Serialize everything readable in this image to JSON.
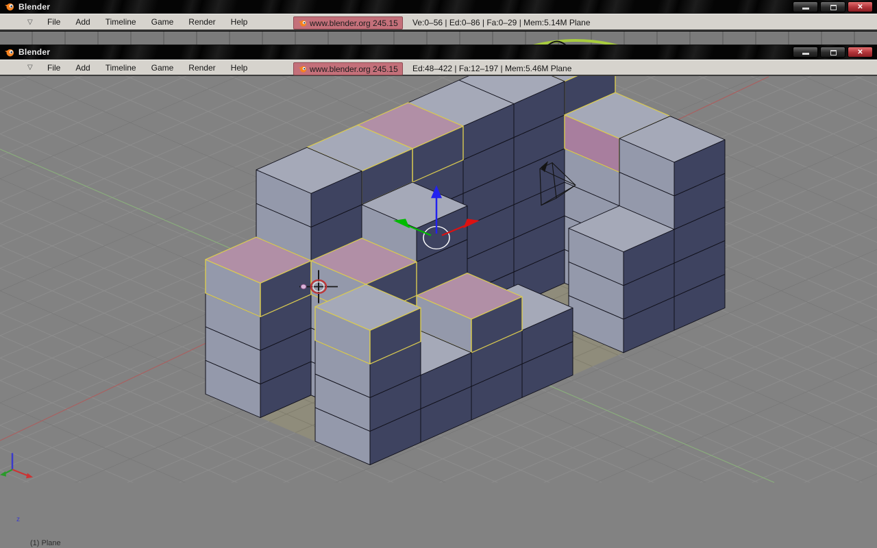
{
  "window1": {
    "title": "Blender",
    "menu": [
      "File",
      "Add",
      "Timeline",
      "Game",
      "Render",
      "Help"
    ],
    "version_badge": "www.blender.org 245.15",
    "stats": "Ve:0–56 | Ed:0–86 | Fa:0–29 | Mem:5.14M Plane"
  },
  "window2": {
    "title": "Blender",
    "menu": [
      "File",
      "Add",
      "Timeline",
      "Game",
      "Render",
      "Help"
    ],
    "version_badge": "www.blender.org 245.15",
    "stats": "Ed:48–422 | Fa:12–197 | Mem:5.46M Plane"
  },
  "icons": {
    "menu_collapse": "▽",
    "close": "✕"
  },
  "viewport": {
    "object_label": "(1) Plane",
    "axis_z_label": "z",
    "colors": {
      "background": "#828282",
      "grid_light": "#8e8e8e",
      "grid_dark": "#757575",
      "axis_x_red": "#aa5f5f",
      "axis_y_green": "#8aad7c",
      "floor": "#8f8c7b",
      "floor_grid": "#7e7b6b",
      "face_top": "#a5a9b8",
      "face_left": "#9499ab",
      "face_right": "#3e4360",
      "face_selected": "#b18fa6",
      "face_selected_side": "#a87e9e",
      "edge": "#10101a",
      "select_edge": "#d9ca52",
      "manip_x": "#dd1111",
      "manip_y": "#00bb00",
      "manip_z": "#2222ee",
      "cursor_red": "#c03535",
      "gizmo_blue": "#3a3acc",
      "gizmo_red": "#cc3333",
      "gizmo_green": "#2a9a2a",
      "sliver_arc": "#a8cc3e"
    }
  }
}
